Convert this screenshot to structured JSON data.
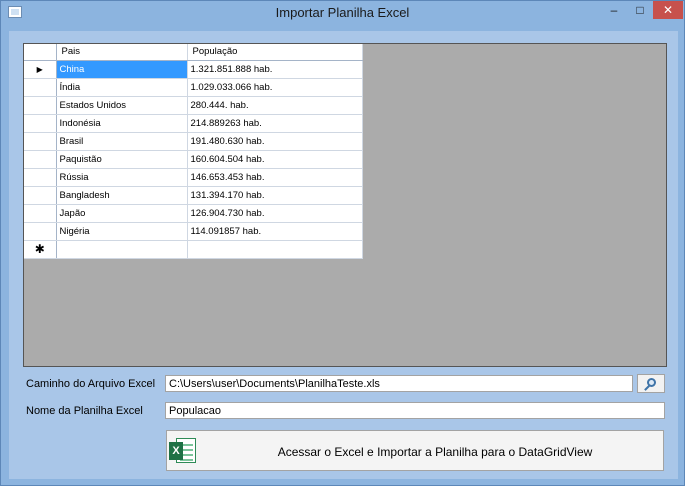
{
  "window": {
    "title": "Importar Planilha Excel",
    "minimize_glyph": "–",
    "maximize_glyph": "□",
    "close_glyph": "✕"
  },
  "grid": {
    "columns": [
      "Pais",
      "População"
    ],
    "rows": [
      {
        "pais": "China",
        "populacao": "1.321.851.888 hab."
      },
      {
        "pais": "Índia",
        "populacao": "1.029.033.066 hab."
      },
      {
        "pais": "Estados Unidos",
        "populacao": "280.444. hab."
      },
      {
        "pais": "Indonésia",
        "populacao": "214.889263 hab."
      },
      {
        "pais": "Brasil",
        "populacao": "191.480.630 hab."
      },
      {
        "pais": "Paquistão",
        "populacao": "160.604.504 hab."
      },
      {
        "pais": "Rússia",
        "populacao": "146.653.453 hab."
      },
      {
        "pais": "Bangladesh",
        "populacao": "131.394.170 hab."
      },
      {
        "pais": "Japão",
        "populacao": "126.904.730 hab."
      },
      {
        "pais": "Nigéria",
        "populacao": "114.091857 hab."
      }
    ],
    "current_row_marker": "▶",
    "new_row_marker": "✱"
  },
  "form": {
    "path_label": "Caminho do Arquivo Excel",
    "path_value": "C:\\Users\\user\\Documents\\PlanilhaTeste.xls",
    "sheet_label": "Nome da Planilha Excel",
    "sheet_value": "Populacao",
    "browse_icon": "magnifier-icon",
    "import_button_label": "Acessar o Excel e Importar a Planilha para o DataGridView",
    "import_icon": "excel-icon",
    "excel_icon_letter": "X"
  },
  "colors": {
    "window_frame": "#8cb4df",
    "client_bg": "#a9c6e8",
    "grid_bg": "#ababab",
    "selection": "#3399ff",
    "close_button": "#c7514d",
    "excel_green": "#1e7145"
  }
}
